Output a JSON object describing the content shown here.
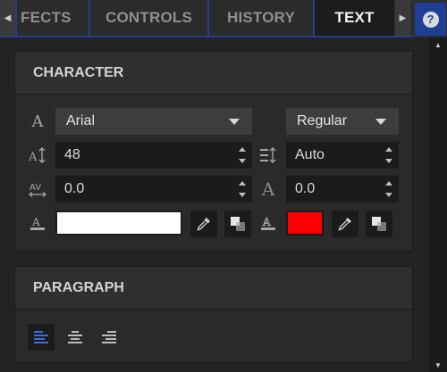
{
  "tabs": [
    {
      "label": "FECTS"
    },
    {
      "label": "CONTROLS"
    },
    {
      "label": "HISTORY"
    },
    {
      "label": "TEXT",
      "active": true
    }
  ],
  "help": {
    "glyph": "?"
  },
  "character": {
    "title": "CHARACTER",
    "font_family": "Arial",
    "font_style": "Regular",
    "font_size": "48",
    "leading": "Auto",
    "tracking": "0.0",
    "baseline_shift": "0.0",
    "fill_color": "#ffffff",
    "stroke_color": "#ff0000"
  },
  "paragraph": {
    "title": "PARAGRAPH",
    "alignments": [
      {
        "icon": "align-left-icon",
        "active": true
      },
      {
        "icon": "align-center-icon",
        "active": false
      },
      {
        "icon": "align-right-icon",
        "active": false
      }
    ]
  },
  "colors": {
    "accent": "#243f8f",
    "active_align": "#3e6de0"
  }
}
